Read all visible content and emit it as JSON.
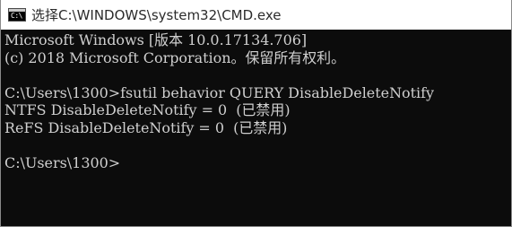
{
  "window": {
    "title": "选择C:\\WINDOWS\\system32\\CMD.exe",
    "icon": "cmd-console-icon",
    "icon_glyph": "C:\\"
  },
  "console": {
    "lines": [
      "Microsoft Windows [版本 10.0.17134.706]",
      "(c) 2018 Microsoft Corporation。保留所有权利。",
      "",
      "C:\\Users\\1300>fsutil behavior QUERY DisableDeleteNotify",
      "NTFS DisableDeleteNotify = 0  (已禁用)",
      "ReFS DisableDeleteNotify = 0  (已禁用)",
      "",
      "C:\\Users\\1300>"
    ]
  },
  "colors": {
    "console_background": "#0c0c0c",
    "console_text": "#cfcfcf",
    "titlebar_background": "#ffffff",
    "titlebar_text": "#2b2b2b"
  }
}
